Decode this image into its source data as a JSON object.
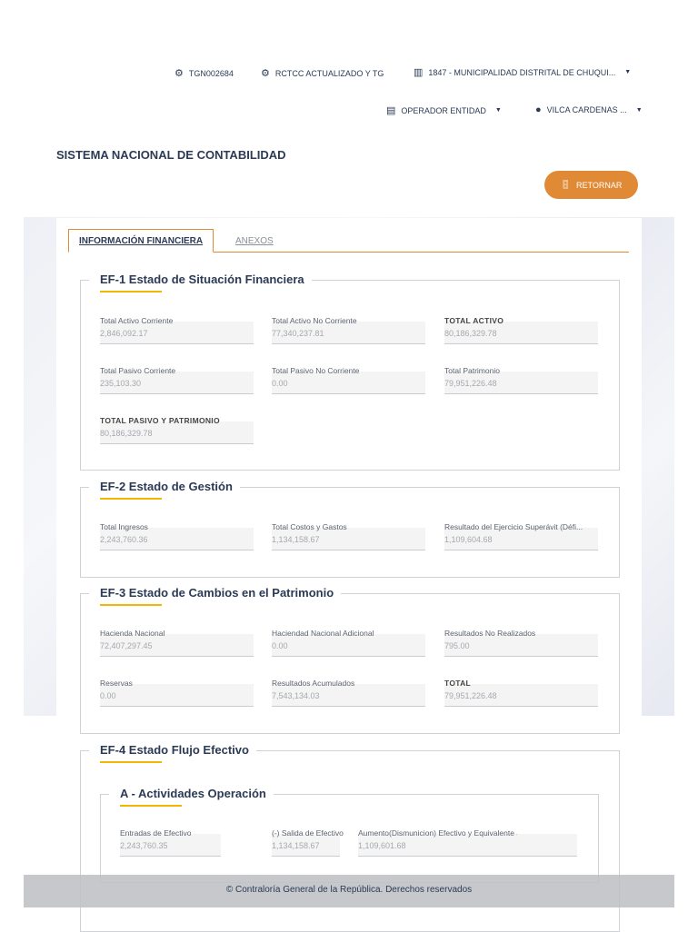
{
  "header": {
    "user_code": "TGN002684",
    "module": "RCTCC ACTUALIZADO Y TG",
    "entity": "1847 - MUNICIPALIDAD DISTRITAL DE CHUQUI...",
    "role": "OPERADOR ENTIDAD",
    "user": "VILCA CARDENAS ..."
  },
  "page_title": "SISTEMA NACIONAL DE CONTABILIDAD",
  "return_button": "RETORNAR",
  "tabs": [
    "INFORMACIÓN FINANCIERA",
    "ANEXOS"
  ],
  "sections": [
    {
      "title": "EF-1 Estado de Situación Financiera",
      "fields": [
        {
          "label": "Total Activo Corriente",
          "value": "2,846,092.17"
        },
        {
          "label": "Total Activo No Corriente",
          "value": "77,340,237.81"
        },
        {
          "label": "TOTAL ACTIVO",
          "value": "80,186,329.78",
          "bold": true
        },
        {
          "label": "Total Pasivo Corriente",
          "value": "235,103.30"
        },
        {
          "label": "Total Pasivo No Corriente",
          "value": "0.00"
        },
        {
          "label": "Total Patrimonio",
          "value": "79,951,226.48"
        },
        {
          "label": "TOTAL PASIVO Y PATRIMONIO",
          "value": "80,186,329.78",
          "bold": true
        }
      ]
    },
    {
      "title": "EF-2 Estado de Gestión",
      "fields": [
        {
          "label": "Total Ingresos",
          "value": "2,243,760.36"
        },
        {
          "label": "Total Costos y Gastos",
          "value": "1,134,158.67"
        },
        {
          "label": "Resultado del Ejercicio Superávit (Défi...",
          "value": "1,109,604.68"
        }
      ]
    },
    {
      "title": "EF-3 Estado de Cambios en el Patrimonio",
      "fields": [
        {
          "label": "Hacienda Nacional",
          "value": "72,407,297.45"
        },
        {
          "label": "Haciendad Nacional Adicional",
          "value": "0.00"
        },
        {
          "label": "Resultados No Realizados",
          "value": "795.00"
        },
        {
          "label": "Reservas",
          "value": "0.00"
        },
        {
          "label": "Resultados Acumulados",
          "value": "7,543,134.03"
        },
        {
          "label": "TOTAL",
          "value": "79,951,226.48",
          "bold": true
        }
      ]
    },
    {
      "title": "EF-4 Estado Flujo Efectivo",
      "subsection": {
        "title": "A - Actividades Operación",
        "fields": [
          {
            "label": "Entradas de Efectivo",
            "value": "2,243,760.35"
          },
          {
            "label": "(-) Salida de Efectivo",
            "value": "1,134,158.67"
          },
          {
            "label": "Aumento(Dismunicion) Efectivo y Equivalente al Efectivo",
            "value": "1,109,601.68"
          }
        ]
      }
    }
  ],
  "footer": "© Contraloría General de la República. Derechos reservados"
}
